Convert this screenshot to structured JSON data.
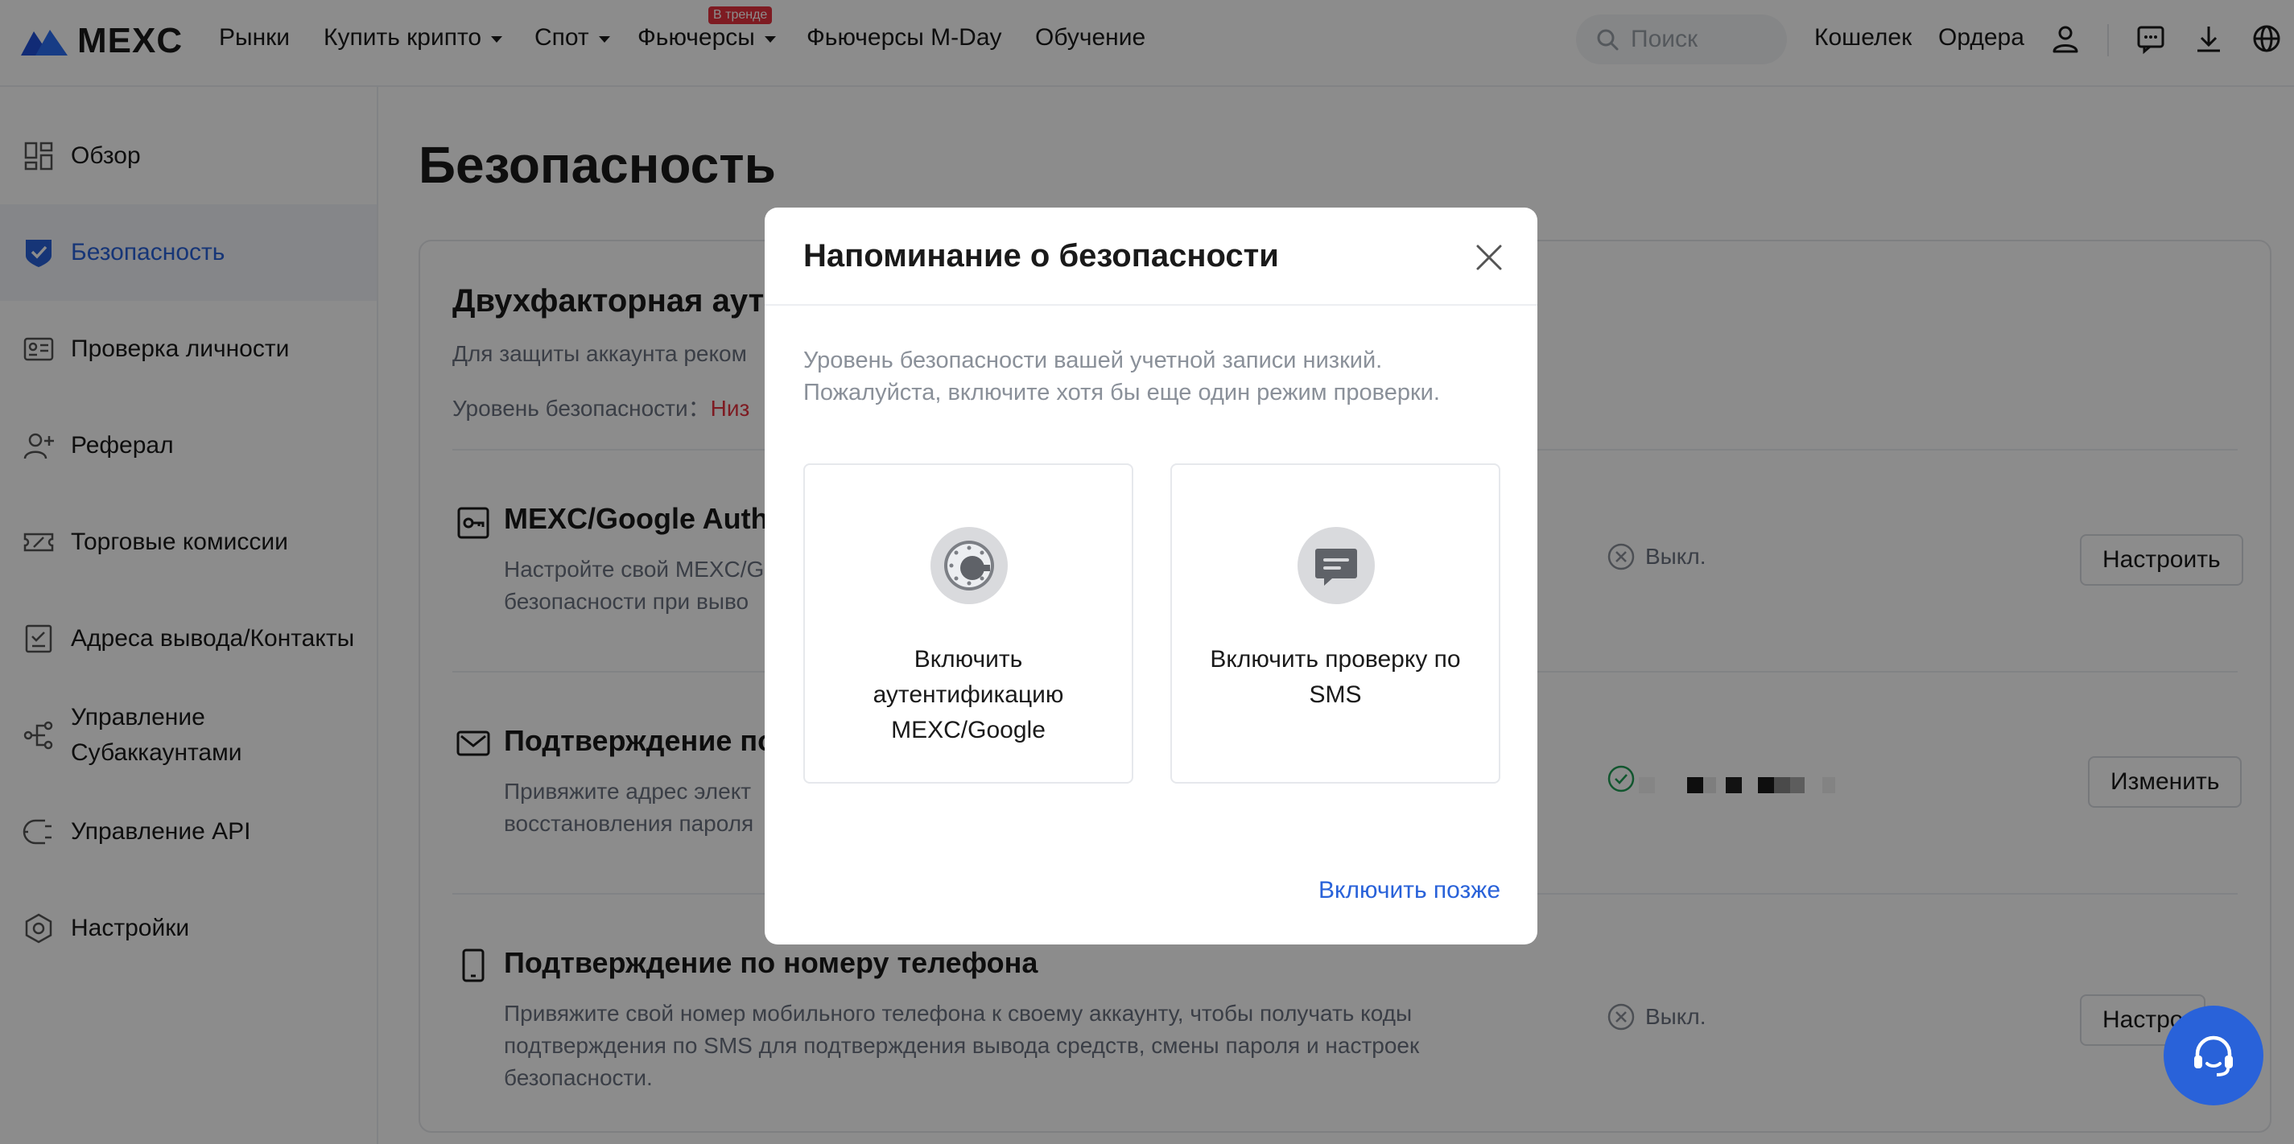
{
  "nav": {
    "logo_text": "MEXC",
    "items": [
      {
        "label": "Рынки",
        "dropdown": false
      },
      {
        "label": "Купить крипто",
        "dropdown": true
      },
      {
        "label": "Спот",
        "dropdown": true
      },
      {
        "label": "Фьючерсы",
        "dropdown": true
      },
      {
        "label": "Фьючерсы M-Day",
        "dropdown": false
      },
      {
        "label": "Обучение",
        "dropdown": false
      }
    ],
    "trend_badge": "В тренде",
    "search_placeholder": "Поиск",
    "wallet": "Кошелек",
    "orders": "Ордера",
    "icons": [
      "user-icon",
      "message-icon",
      "download-icon",
      "globe-icon"
    ]
  },
  "sidebar": {
    "items": [
      {
        "label": "Обзор",
        "icon": "dashboard-icon",
        "active": false
      },
      {
        "label": "Безопасность",
        "icon": "shield-icon",
        "active": true
      },
      {
        "label": "Проверка личности",
        "icon": "id-card-icon",
        "active": false
      },
      {
        "label": "Реферал",
        "icon": "user-add-icon",
        "active": false
      },
      {
        "label": "Торговые комиссии",
        "icon": "ticket-icon",
        "active": false
      },
      {
        "label": "Адреса вывода/Контакты",
        "icon": "address-book-icon",
        "active": false
      },
      {
        "label": "Управление Субаккаунтами",
        "icon": "subaccount-icon",
        "active": false
      },
      {
        "label": "Управление API",
        "icon": "api-icon",
        "active": false
      },
      {
        "label": "Настройки",
        "icon": "settings-icon",
        "active": false
      }
    ]
  },
  "main": {
    "title": "Безопасность",
    "card": {
      "title": "Двухфакторная ауте",
      "desc": "Для защиты аккаунта реком",
      "level_label": "Уровень безопасности：",
      "level_value": "Низ",
      "options": [
        {
          "title": "MEXC/Google Authe",
          "desc_line1": "Настройте свой MEXC/G",
          "desc_line2": "безопасности при выво",
          "status": "Выкл.",
          "button": "Настроить",
          "icon": "authenticator-key-icon"
        },
        {
          "title": "Подтверждение по",
          "desc_line1": "Привяжите адрес элект",
          "desc_line2": "восстановления пароля",
          "status": "",
          "button": "Изменить",
          "icon": "envelope-icon"
        },
        {
          "title": "Подтверждение по номеру телефона",
          "desc_line1": "Привяжите свой номер мобильного телефона к своему аккаунту, чтобы получать коды",
          "desc_line2": "подтверждения по SMS для подтверждения вывода средств, смены пароля и настроек",
          "desc_line3": "безопасности.",
          "status": "Выкл.",
          "button": "Настро",
          "icon": "phone-icon"
        }
      ]
    }
  },
  "modal": {
    "title": "Напоминание о безопасности",
    "text_line1": "Уровень безопасности вашей учетной записи низкий.",
    "text_line2": "Пожалуйста, включите хотя бы еще один режим проверки.",
    "choices": [
      {
        "label_line1": "Включить",
        "label_line2": "аутентификацию",
        "label_line3": "MEXC/Google",
        "icon": "google-authenticator-icon"
      },
      {
        "label_line1": "Включить проверку по",
        "label_line2": "SMS",
        "label_line3": "",
        "icon": "sms-icon"
      }
    ],
    "later_link": "Включить позже"
  },
  "colors": {
    "accent": "#2962d9",
    "danger": "#e5323e",
    "success": "#1f9d55",
    "overlay": "rgba(0,0,0,0.45)"
  }
}
